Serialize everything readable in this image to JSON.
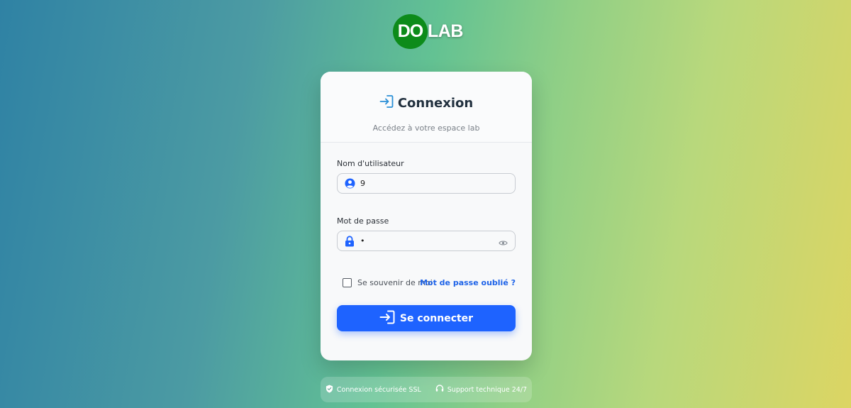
{
  "logo": {
    "circle_text": "DO",
    "text": "LAB",
    "brand_color": "#0d8b1a"
  },
  "card": {
    "title": "Connexion",
    "title_icon": "login-icon",
    "subtitle": "Accédez à votre espace lab"
  },
  "form": {
    "username": {
      "label": "Nom d'utilisateur",
      "value": "9",
      "icon": "user-circle-icon"
    },
    "password": {
      "label": "Mot de passe",
      "value": "•",
      "icon": "lock-icon",
      "toggle_icon": "eye-icon"
    },
    "remember_label": "Se souvenir de moi",
    "remember_checked": false,
    "forgot_label": "Mot de passe oublié ?",
    "submit_label": "Se connecter",
    "submit_icon": "login-icon"
  },
  "footer": {
    "items": [
      {
        "icon": "shield-icon",
        "label": "Connexion sécurisée SSL"
      },
      {
        "icon": "headset-icon",
        "label": "Support technique 24/7"
      }
    ]
  },
  "colors": {
    "primary": "#1e63ff",
    "link": "#1e63e8",
    "icon_blue": "#1e63ff"
  }
}
